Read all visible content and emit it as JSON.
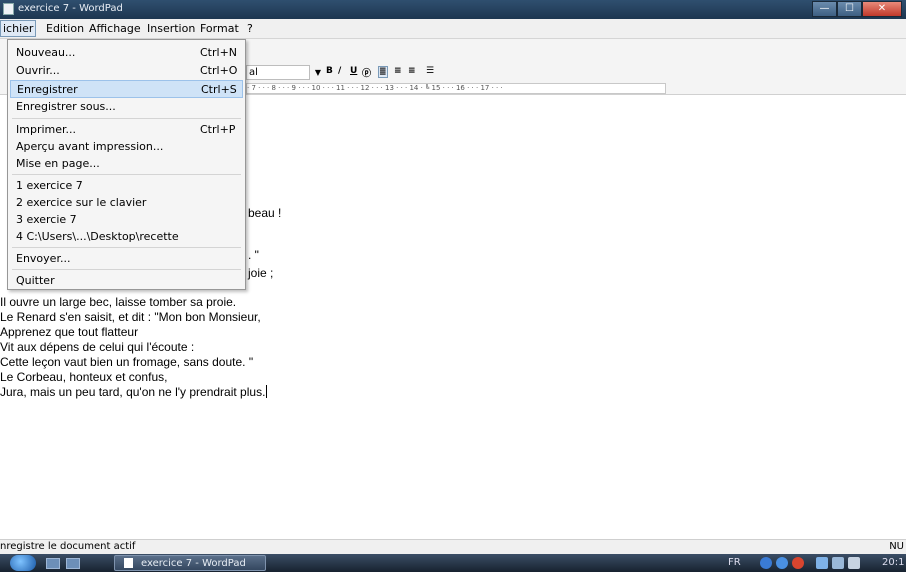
{
  "window": {
    "title": "exercice 7 - WordPad",
    "controls": {
      "minimize": "—",
      "maximize": "☐",
      "close": "✕"
    }
  },
  "menubar": {
    "items": [
      "ichier",
      "Edition",
      "Affichage",
      "Insertion",
      "Format",
      "?"
    ],
    "active": "ichier"
  },
  "format_bar": {
    "font_value": "al",
    "buttons": [
      "B",
      "/",
      "U",
      "ⓟ",
      "≣",
      "≡",
      "≡",
      "☰"
    ]
  },
  "ruler": {
    "text": "· 7 · · · 8 · · · 9 · · · 10 · · · 11 · · · 12 · · · 13 · · · 14 · ╚ 15 · · · 16 · · · 17 · · ·"
  },
  "file_menu": {
    "items": [
      {
        "label": "Nouveau...",
        "shortcut": "Ctrl+N"
      },
      {
        "label": "Ouvrir...",
        "shortcut": "Ctrl+O"
      },
      {
        "label": "Enregistrer",
        "shortcut": "Ctrl+S",
        "highlighted": true
      },
      {
        "label": "Enregistrer sous...",
        "shortcut": ""
      },
      {
        "label": "Imprimer...",
        "shortcut": "Ctrl+P"
      },
      {
        "label": "Aperçu avant impression...",
        "shortcut": ""
      },
      {
        "label": "Mise en page...",
        "shortcut": ""
      },
      {
        "label": "1 exercice 7",
        "shortcut": ""
      },
      {
        "label": "2 exercice sur le clavier",
        "shortcut": ""
      },
      {
        "label": "3 exercie 7",
        "shortcut": ""
      },
      {
        "label": "4 C:\\Users\\...\\Desktop\\recette",
        "shortcut": ""
      },
      {
        "label": "Envoyer...",
        "shortcut": ""
      },
      {
        "label": "Quitter",
        "shortcut": ""
      }
    ]
  },
  "document": {
    "fragments": [
      "beau !",
      ". \"",
      "joie ;"
    ],
    "lines": [
      "Il ouvre un large bec, laisse tomber sa proie.",
      "Le Renard s'en saisit, et dit : \"Mon bon Monsieur,",
      "Apprenez que tout flatteur",
      "Vit aux dépens de celui qui l'écoute :",
      "Cette leçon vaut bien un fromage, sans doute. \"",
      "Le Corbeau, honteux et confus,",
      "Jura, mais un peu tard, qu'on ne l'y prendrait plus."
    ]
  },
  "statusbar": {
    "message": "nregistre le document actif",
    "indicator": "NU"
  },
  "taskbar": {
    "task_label": "exercice 7 - WordPad",
    "language": "FR",
    "clock": "20:1"
  },
  "colors": {
    "titlebar": "#1d3650",
    "menu_highlight": "#cfe3f7",
    "close_button": "#c0392b"
  }
}
